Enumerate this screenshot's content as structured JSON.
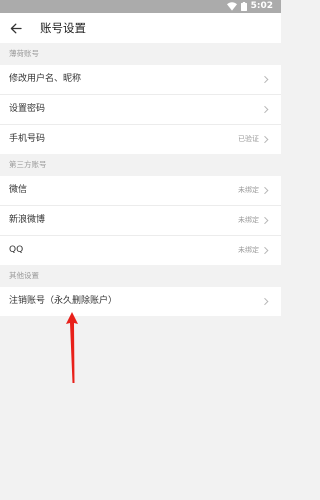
{
  "status_bar": {
    "time": "5:02"
  },
  "app_bar": {
    "title": "账号设置"
  },
  "sections": [
    {
      "header": "薄荷账号",
      "rows": [
        {
          "label": "修改用户名、昵称",
          "value": ""
        },
        {
          "label": "设置密码",
          "value": ""
        },
        {
          "label": "手机号码",
          "value": "已验证"
        }
      ]
    },
    {
      "header": "第三方账号",
      "rows": [
        {
          "label": "微信",
          "value": "未绑定"
        },
        {
          "label": "新浪微博",
          "value": "未绑定"
        },
        {
          "label": "QQ",
          "value": "未绑定"
        }
      ]
    },
    {
      "header": "其他设置",
      "rows": [
        {
          "label": "注销账号（永久删除账户）",
          "value": ""
        }
      ]
    }
  ],
  "colors": {
    "annotation_arrow": "#e8201a",
    "status_bar_bg": "#ababab"
  },
  "icons": {
    "back": "arrow-left-icon",
    "row_chevron": "chevron-right-icon",
    "wifi": "wifi-icon",
    "battery": "battery-icon"
  }
}
